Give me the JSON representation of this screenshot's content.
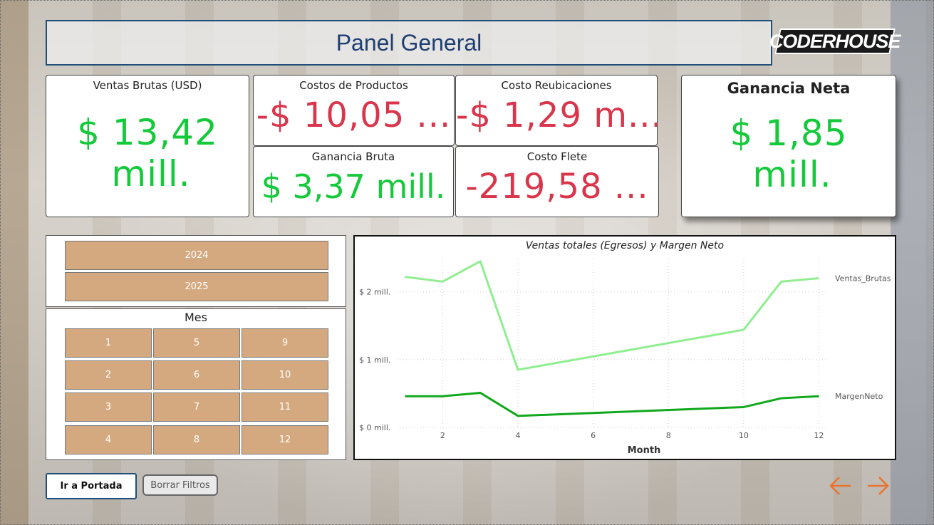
{
  "header": {
    "title": "Panel General",
    "logo_text": "CODERHOUSE"
  },
  "kpis": {
    "ventas_brutas": {
      "label": "Ventas Brutas (USD)",
      "value_line1": "$ 13,42",
      "value_line2": "mill."
    },
    "costos_productos": {
      "label": "Costos de Productos",
      "value": "-$ 10,05 ..."
    },
    "costo_reubicaciones": {
      "label": "Costo Reubicaciones",
      "value": "-$ 1,29 m..."
    },
    "ganancia_bruta": {
      "label": "Ganancia Bruta",
      "value": "$ 3,37 mill."
    },
    "costo_flete": {
      "label": "Costo Flete",
      "value": "-219,58 ..."
    },
    "ganancia_neta": {
      "label": "Ganancia Neta",
      "value_line1": "$ 1,85",
      "value_line2": "mill."
    }
  },
  "filters": {
    "years": [
      "2024",
      "2025"
    ],
    "mes_title": "Mes",
    "months": [
      "1",
      "5",
      "9",
      "2",
      "6",
      "10",
      "3",
      "7",
      "11",
      "4",
      "8",
      "12"
    ]
  },
  "buttons": {
    "home": "Ir a Portada",
    "clear": "Borrar Filtros"
  },
  "colors": {
    "accent_blue": "#1f4e79",
    "positive": "#14c93a",
    "negative": "#d9354b",
    "slicer": "#d5a97f",
    "arrow": "#e8742f"
  },
  "icons": {
    "prev": "arrow-left-icon",
    "next": "arrow-right-icon"
  },
  "chart_data": {
    "type": "line",
    "title": "Ventas totales (Egresos) y Margen Neto",
    "xlabel": "Month",
    "ylabel": "",
    "x": [
      1,
      2,
      3,
      4,
      10,
      11,
      12
    ],
    "xticks": [
      "2",
      "4",
      "6",
      "8",
      "10",
      "12"
    ],
    "yticks": [
      "$ 0 mill.",
      "$ 1 mill.",
      "$ 2 mill."
    ],
    "xlim": [
      0.8,
      12.2
    ],
    "ylim": [
      0,
      2.5
    ],
    "grid": true,
    "legend": "end-of-line labels",
    "series": [
      {
        "name": "Ventas_Brutas",
        "color": "#90ee90",
        "values": [
          2.22,
          2.15,
          2.45,
          0.85,
          1.44,
          2.15,
          2.2
        ]
      },
      {
        "name": "MargenNeto",
        "color": "#10a81c",
        "values": [
          0.46,
          0.46,
          0.51,
          0.17,
          0.3,
          0.43,
          0.46
        ]
      }
    ]
  }
}
